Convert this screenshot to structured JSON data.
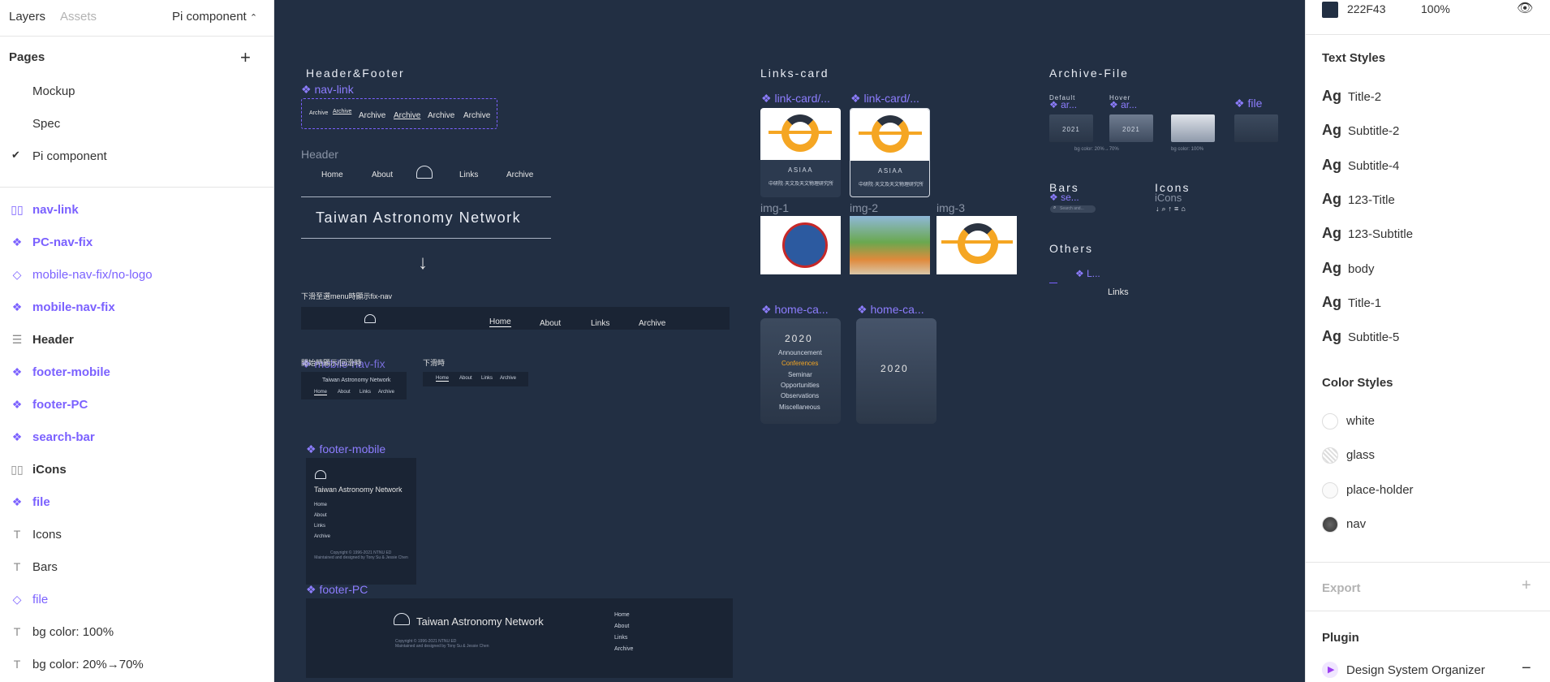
{
  "left": {
    "tab_layers": "Layers",
    "tab_assets": "Assets",
    "page_selector": "Pi component",
    "pages_heading": "Pages",
    "pages": [
      "Mockup",
      "Spec",
      "Pi component"
    ],
    "layers": [
      {
        "label": "nav-link",
        "icon": "layout-columns-icon"
      },
      {
        "label": "PC-nav-fix",
        "icon": "component-icon"
      },
      {
        "label": "mobile-nav-fix/no-logo",
        "icon": "instance-icon"
      },
      {
        "label": "mobile-nav-fix",
        "icon": "component-icon"
      },
      {
        "label": "Header",
        "icon": "layout-rows-icon"
      },
      {
        "label": "footer-mobile",
        "icon": "component-icon"
      },
      {
        "label": "footer-PC",
        "icon": "component-icon"
      },
      {
        "label": "search-bar",
        "icon": "component-icon"
      },
      {
        "label": "iCons",
        "icon": "layout-columns-icon"
      },
      {
        "label": "file",
        "icon": "component-icon"
      },
      {
        "label": "Icons",
        "icon": "text-icon"
      },
      {
        "label": "Bars",
        "icon": "text-icon"
      },
      {
        "label": "file",
        "icon": "instance-icon"
      },
      {
        "label": "bg color: 100%",
        "icon": "text-icon"
      },
      {
        "label": "bg color: 20%→70%",
        "icon": "text-icon"
      }
    ]
  },
  "canvas": {
    "header_footer_title": "Header&Footer",
    "nav_link": "nav-link",
    "nav_link_items": [
      "Archive",
      "Archive",
      "Archive",
      "Archive",
      "Archive",
      "Archive"
    ],
    "header_label": "Header",
    "header_nav": [
      "Home",
      "About",
      "Links",
      "Archive"
    ],
    "site_title": "Taiwan Astronomy Network",
    "arrow": "↓",
    "pc_nav_note": "下滑至選menu時顯示fix-nav",
    "pc_nav_items": [
      "Home",
      "About",
      "Links",
      "Archive"
    ],
    "mobile_nav_label": "mobile-nav-fix",
    "mobile_note_left": "開始時顯示/回滑時",
    "mobile_note_right": "下滑時",
    "mobile_site_title": "Taiwan Astronomy Network",
    "mobile_nav_items": [
      "Home",
      "About",
      "Links",
      "Archive"
    ],
    "footer_mobile_label": "footer-mobile",
    "footer_links": [
      "Home",
      "About",
      "Links",
      "Archive"
    ],
    "footer_copyright": "Copyright © 1996-2021 NTNU ED",
    "footer_credit_mobile": "Maintained and designed by Tony Su & Jessie Chen",
    "footer_pc_label": "footer-PC",
    "footer_credit_pc": "Maintained and designed by Tony Su & Jessie Chen",
    "links_card_title": "Links-card",
    "link_card_1": "link-card/...",
    "link_card_2": "link-card/...",
    "card_name": "ASIAA",
    "card_subtitle": "中研院·天文及天文物理研究所",
    "img_labels": [
      "img-1",
      "img-2",
      "img-3"
    ],
    "home_card_1": "home-ca...",
    "home_card_2": "home-ca...",
    "year": "2020",
    "home_list": [
      "Announcement",
      "Conferences",
      "Seminar",
      "Opportunities",
      "Observations",
      "Miscellaneous"
    ],
    "archive_title": "Archive-File",
    "default_label": "Default",
    "hover_label": "Hover",
    "archive_comp": "ar...",
    "file_comp": "file",
    "file_year": "2021",
    "bg_note_1": "bg color: 20%→70%",
    "bg_note_2": "bg color: 100%",
    "bars_title": "Bars",
    "bars_comp": "se...",
    "search_placeholder": "Search and...",
    "icons_title": "Icons",
    "icons_sub": "iCons",
    "others_title": "Others",
    "others_comp": "L...",
    "links_label": "Links"
  },
  "right": {
    "fill_hex": "222F43",
    "fill_opacity": "100%",
    "text_styles_heading": "Text Styles",
    "text_styles": [
      "Title-2",
      "Subtitle-2",
      "Subtitle-4",
      "123-Title",
      "123-Subtitle",
      "body",
      "Title-1",
      "Subtitle-5"
    ],
    "text_style_prefix": "Ag",
    "color_styles_heading": "Color Styles",
    "color_styles": [
      "white",
      "glass",
      "place-holder",
      "nav"
    ],
    "export_label": "Export",
    "plugin_heading": "Plugin",
    "plugin_name": "Design System Organizer"
  },
  "colors": {
    "canvas_bg": "#222F43",
    "component_purple": "#7B61FF",
    "accent_orange": "#F5A623"
  }
}
